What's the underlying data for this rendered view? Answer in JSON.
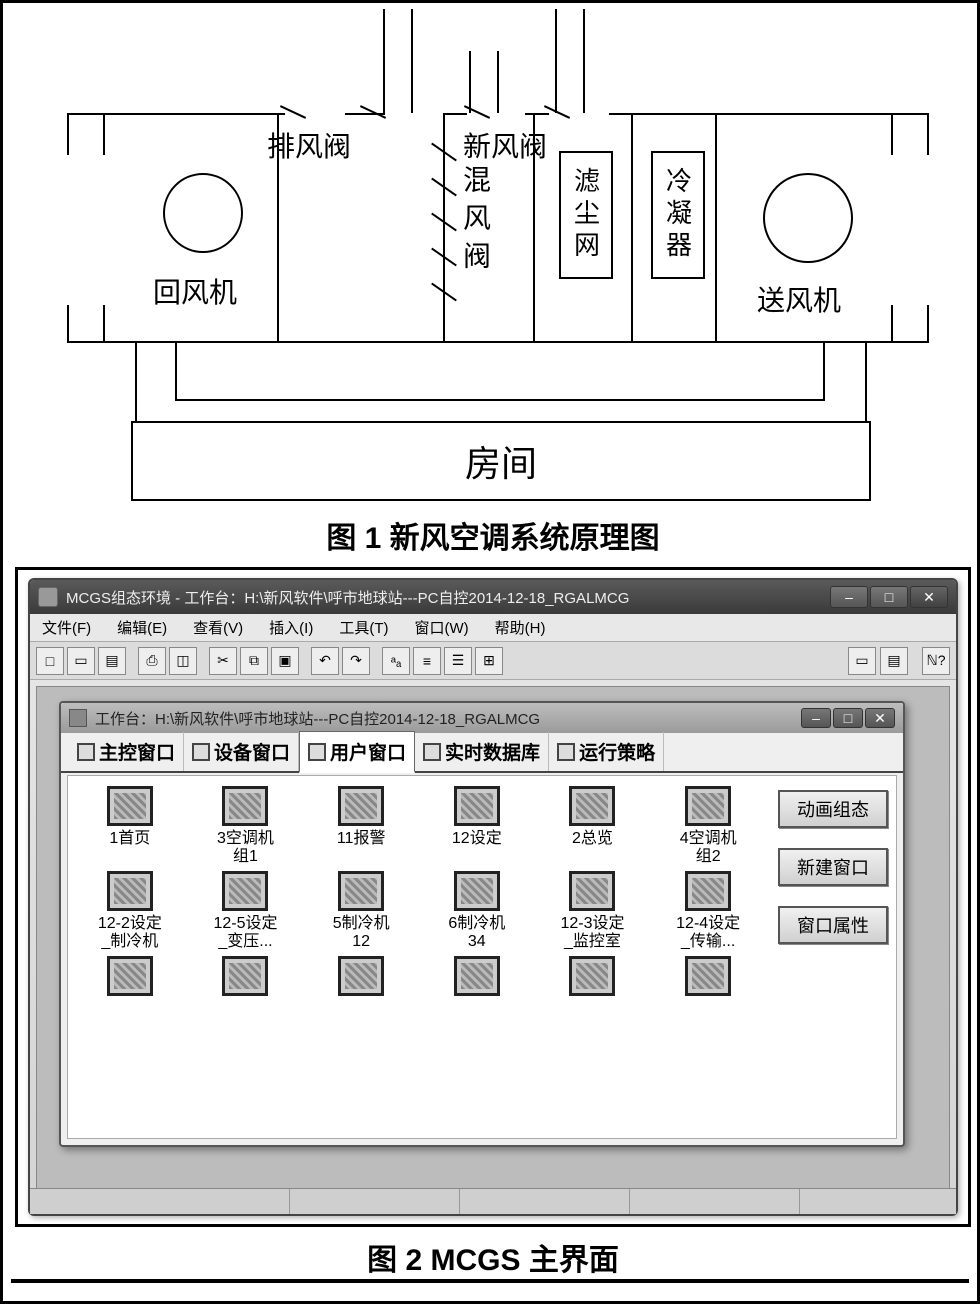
{
  "fig1": {
    "caption": "图 1 新风空调系统原理图",
    "labels": {
      "exhaust_valve": "排风阀",
      "fresh_valve": "新风阀",
      "mix_valve": "混风阀",
      "filter": "滤尘网",
      "condenser": "冷凝器",
      "return_fan": "回风机",
      "supply_fan": "送风机",
      "room": "房间"
    }
  },
  "fig2": {
    "caption": "图 2 MCGS 主界面",
    "window_title": "MCGS组态环境 - 工作台：H:\\新风软件\\呼市地球站---PC自控2014-12-18_RGALMCG",
    "menus": [
      "文件(F)",
      "编辑(E)",
      "查看(V)",
      "插入(I)",
      "工具(T)",
      "窗口(W)",
      "帮助(H)"
    ],
    "child_title": "工作台：H:\\新风软件\\呼市地球站---PC自控2014-12-18_RGALMCG",
    "tabs": [
      {
        "label": "主控窗口"
      },
      {
        "label": "设备窗口"
      },
      {
        "label": "用户窗口"
      },
      {
        "label": "实时数据库"
      },
      {
        "label": "运行策略"
      }
    ],
    "side_buttons": [
      "动画组态",
      "新建窗口",
      "窗口属性"
    ],
    "windows": [
      {
        "label": "1首页"
      },
      {
        "label": "3空调机\n组1"
      },
      {
        "label": "11报警"
      },
      {
        "label": "12设定"
      },
      {
        "label": "2总览"
      },
      {
        "label": "4空调机\n组2"
      },
      {
        "label": "12-2设定\n_制冷机"
      },
      {
        "label": "12-5设定\n_变压..."
      },
      {
        "label": "5制冷机\n12"
      },
      {
        "label": "6制冷机\n34"
      },
      {
        "label": "12-3设定\n_监控室"
      },
      {
        "label": "12-4设定\n_传输..."
      },
      {
        "label": ""
      },
      {
        "label": ""
      },
      {
        "label": ""
      },
      {
        "label": ""
      },
      {
        "label": ""
      },
      {
        "label": ""
      }
    ]
  }
}
